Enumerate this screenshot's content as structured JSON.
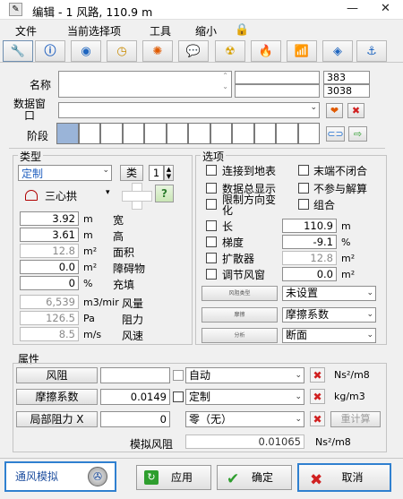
{
  "window": {
    "title": "编辑 - 1 风路, 110.9 m",
    "minimize": "—",
    "close": "✕"
  },
  "menu": [
    "文件",
    "当前选择项",
    "工具",
    "缩小"
  ],
  "toolbar_icons": [
    "wrench-icon",
    "info-icon",
    "globe-icon",
    "clock-icon",
    "fire-icon",
    "speech-bubble-icon",
    "radiation-icon",
    "dropper-icon",
    "wifi-icon",
    "stack-icon",
    "plug-icon"
  ],
  "header": {
    "name_label": "名称",
    "data_window_label": "数据窗\n口",
    "stage_label": "阶段",
    "id1": "383",
    "id2": "3038"
  },
  "type": {
    "title": "类型",
    "type_value": "定制",
    "type_button": "类",
    "spinner_value": "1",
    "shape_label": "三心拱",
    "help": "?",
    "rows": [
      {
        "value": "3.92",
        "unit": "m",
        "label": "宽"
      },
      {
        "value": "3.61",
        "unit": "m",
        "label": "高"
      },
      {
        "value": "12.8",
        "unit": "m²",
        "label": "面积"
      },
      {
        "value": "0.0",
        "unit": "m²",
        "label": "障碍物"
      },
      {
        "value": "0",
        "unit": "%",
        "label": "充填"
      },
      {
        "value": "6,539",
        "unit": "m3/mir",
        "label": "风量"
      },
      {
        "value": "126.5",
        "unit": "Pa",
        "label": "阻力"
      },
      {
        "value": "8.5",
        "unit": "m/s",
        "label": "风速"
      }
    ]
  },
  "options": {
    "title": "选项",
    "left_checks": [
      "连接到地表",
      "数据总显示",
      "限制方向变\n化",
      "长",
      "梯度",
      "扩散器",
      "调节风窗"
    ],
    "right_checks": [
      "末端不闭合",
      "不参与解算",
      "组合"
    ],
    "length_value": "110.9",
    "length_unit": "m",
    "gradient_value": "-9.1",
    "gradient_unit": "%",
    "diffuser_value": "12.8",
    "diffuser_unit": "m²",
    "regulator_value": "0.0",
    "regulator_unit": "m²",
    "selectors": [
      {
        "button": "风阻类型",
        "value": "未设置"
      },
      {
        "button": "摩擦",
        "value": "摩擦系数"
      },
      {
        "button": "分析",
        "value": "断面"
      }
    ]
  },
  "properties": {
    "title": "属性",
    "rows": [
      {
        "button": "风阻",
        "value": "",
        "mode": "自动",
        "unit": "Ns²/m8"
      },
      {
        "button": "摩擦系数",
        "value": "0.0149",
        "mode": "定制",
        "unit": "kg/m3"
      },
      {
        "button": "局部阻力 X",
        "value": "0",
        "mode": "零（无）",
        "unit": "",
        "extra": "重计算"
      }
    ],
    "sim_label": "模拟风阻",
    "sim_value": "0.01065",
    "sim_unit": "Ns²/m8"
  },
  "footer": {
    "simulate": "通风模拟",
    "apply": "应用",
    "ok": "确定",
    "cancel": "取消"
  }
}
